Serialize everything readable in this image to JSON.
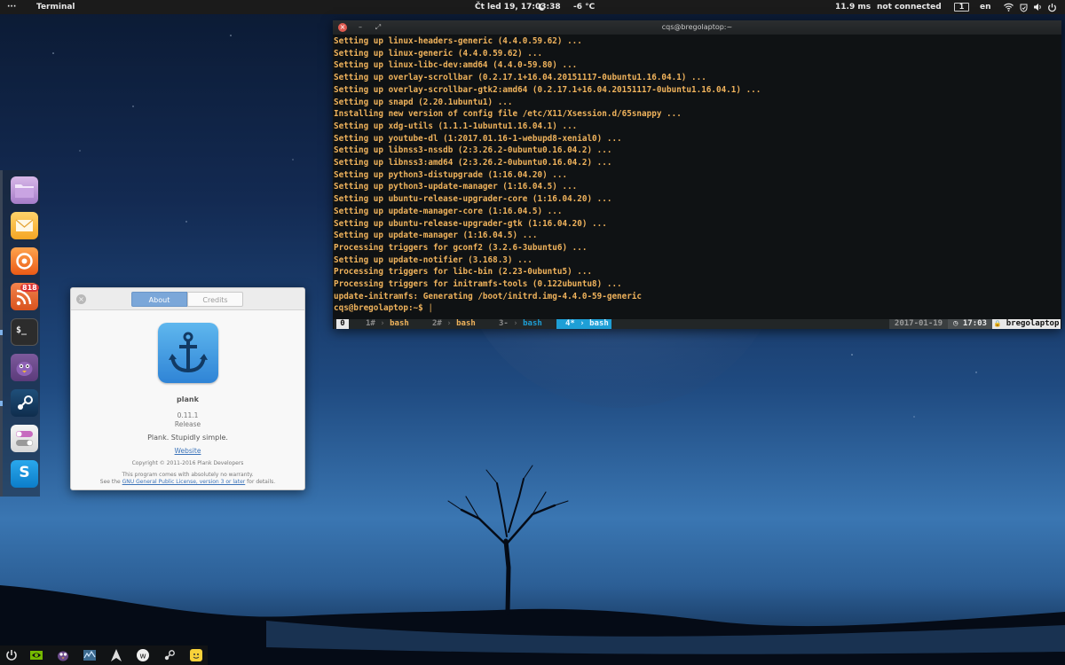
{
  "top_panel": {
    "menu_label": "···",
    "app_name": "Terminal",
    "datetime": "Čt led 19, 17:03:38",
    "weather": "-6 °C",
    "ping": "11.9 ms",
    "network": "not connected",
    "workspace": "1",
    "keyboard_layout": "en"
  },
  "terminal": {
    "title": "cqs@bregolaptop:~",
    "lines": [
      "Setting up linux-headers-generic (4.4.0.59.62) ...",
      "Setting up linux-generic (4.4.0.59.62) ...",
      "Setting up linux-libc-dev:amd64 (4.4.0-59.80) ...",
      "Setting up overlay-scrollbar (0.2.17.1+16.04.20151117-0ubuntu1.16.04.1) ...",
      "Setting up overlay-scrollbar-gtk2:amd64 (0.2.17.1+16.04.20151117-0ubuntu1.16.04.1) ...",
      "Setting up snapd (2.20.1ubuntu1) ...",
      "Installing new version of config file /etc/X11/Xsession.d/65snappy ...",
      "Setting up xdg-utils (1.1.1-1ubuntu1.16.04.1) ...",
      "Setting up youtube-dl (1:2017.01.16-1-webupd8-xenial0) ...",
      "Setting up libnss3-nssdb (2:3.26.2-0ubuntu0.16.04.2) ...",
      "Setting up libnss3:amd64 (2:3.26.2-0ubuntu0.16.04.2) ...",
      "Setting up python3-distupgrade (1:16.04.20) ...",
      "Setting up python3-update-manager (1:16.04.5) ...",
      "Setting up ubuntu-release-upgrader-core (1:16.04.20) ...",
      "Setting up update-manager-core (1:16.04.5) ...",
      "Setting up ubuntu-release-upgrader-gtk (1:16.04.20) ...",
      "Setting up update-manager (1:16.04.5) ...",
      "Processing triggers for gconf2 (3.2.6-3ubuntu6) ...",
      "Setting up update-notifier (3.168.3) ...",
      "Processing triggers for libc-bin (2.23-0ubuntu5) ...",
      "Processing triggers for initramfs-tools (0.122ubuntu8) ...",
      "update-initramfs: Generating /boot/initrd.img-4.4.0-59-generic"
    ],
    "prompt": "cqs@bregolaptop:~$ ",
    "cursor": "|"
  },
  "tmux": {
    "session": "0",
    "windows": [
      {
        "index": "1#",
        "name": "bash"
      },
      {
        "index": "2#",
        "name": "bash"
      },
      {
        "index": "3-",
        "name": "bash"
      },
      {
        "index": "4*",
        "name": "bash"
      }
    ],
    "date": "2017-01-19",
    "time_icon": "◷",
    "time": "17:03",
    "lock_icon": "🔒",
    "host": "bregolaptop"
  },
  "dock": {
    "items": [
      {
        "name": "files",
        "icon": "folder-icon"
      },
      {
        "name": "mail",
        "icon": "mail-icon"
      },
      {
        "name": "firefox",
        "icon": "firefox-icon"
      },
      {
        "name": "rss",
        "icon": "rss-icon",
        "badge": "818"
      },
      {
        "name": "terminal",
        "icon": "terminal-icon",
        "label": "$_"
      },
      {
        "name": "pidgin",
        "icon": "pidgin-icon"
      },
      {
        "name": "steam",
        "icon": "steam-icon"
      },
      {
        "name": "settings",
        "icon": "toggles-icon"
      },
      {
        "name": "skype",
        "icon": "skype-icon",
        "label": "S"
      }
    ]
  },
  "about_dialog": {
    "tabs": [
      "About",
      "Credits"
    ],
    "app_name": "plank",
    "version": "0.11.1",
    "release": "Release",
    "tagline": "Plank. Stupidly simple.",
    "website_label": "Website",
    "copyright": "Copyright © 2011-2016 Plank Developers",
    "license_line1": "This program comes with absolutely no warranty.",
    "license_prefix": "See the ",
    "license_link": "GNU General Public License, version 3 or later",
    "license_suffix": " for details."
  },
  "bottom_tray": {
    "items": [
      "power-icon",
      "nvidia-icon",
      "pidgin-tray-icon",
      "system-monitor-icon",
      "arch-like-icon",
      "wunderlist-icon",
      "steam-tray-icon",
      "notes-icon"
    ]
  },
  "colors": {
    "terminal_text": "#f0b35c",
    "tmux_active": "#1e9fd6",
    "dialog_accent": "#7ba7d9"
  }
}
